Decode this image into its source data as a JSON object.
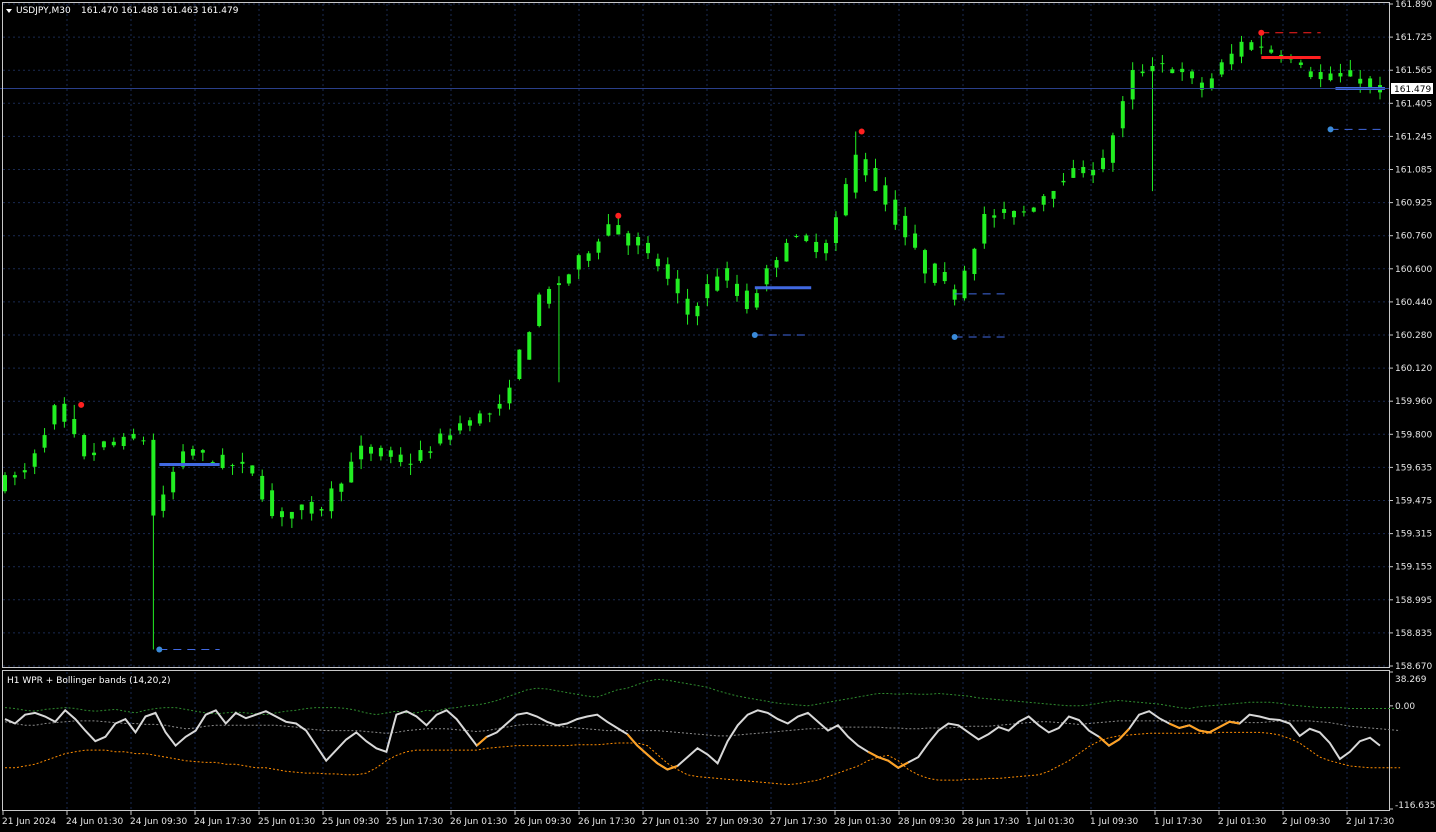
{
  "header": {
    "symbol_info": "USDJPY,M30",
    "ohlc": "161.470 161.488 161.463 161.479"
  },
  "indicator": {
    "title": "H1 WPR + Bollinger bands (14,20,2)",
    "scale_labels": [
      "38.269",
      "0.00",
      "-116.6359"
    ]
  },
  "current_price": "161.479",
  "price_axis": [
    "161.890",
    "161.725",
    "161.565",
    "161.405",
    "161.245",
    "161.085",
    "160.925",
    "160.760",
    "160.600",
    "160.440",
    "160.280",
    "160.120",
    "159.960",
    "159.800",
    "159.635",
    "159.475",
    "159.315",
    "159.155",
    "158.995",
    "158.835",
    "158.670"
  ],
  "time_axis": [
    "21 Jun 2024",
    "24 Jun 01:30",
    "24 Jun 09:30",
    "24 Jun 17:30",
    "25 Jun 01:30",
    "25 Jun 09:30",
    "25 Jun 17:30",
    "26 Jun 01:30",
    "26 Jun 09:30",
    "26 Jun 17:30",
    "27 Jun 01:30",
    "27 Jun 09:30",
    "27 Jun 17:30",
    "28 Jun 01:30",
    "28 Jun 09:30",
    "28 Jun 17:30",
    "1 Jul 01:30",
    "1 Jul 09:30",
    "1 Jul 17:30",
    "2 Jul 01:30",
    "2 Jul 09:30",
    "2 Jul 17:30"
  ],
  "colors": {
    "background": "#000000",
    "grid": "#1a2a52",
    "candle": "#22ee22",
    "level": "#4169e1",
    "marker_high": "#ff2020",
    "marker_low": "#3a8ad8",
    "wpr": "#d8d8d8",
    "wpr_extreme": "#ffa020",
    "band_upper": "#2e8b2e",
    "band_mid": "#8a8a8a",
    "band_lower": "#ff8c00",
    "text": "#e6e6e6"
  },
  "chart_data": {
    "type": "candlestick",
    "y_range": [
      158.67,
      161.89
    ],
    "key_points": [
      {
        "t": 0,
        "p": 159.55
      },
      {
        "t": 3,
        "p": 159.62
      },
      {
        "t": 6,
        "p": 159.92
      },
      {
        "t": 9,
        "p": 159.7
      },
      {
        "t": 12,
        "p": 159.76
      },
      {
        "t": 15,
        "p": 159.78
      },
      {
        "t": 16,
        "p": 159.4
      },
      {
        "t": 19,
        "p": 159.72
      },
      {
        "t": 23,
        "p": 159.65
      },
      {
        "t": 26,
        "p": 159.62
      },
      {
        "t": 28,
        "p": 159.4
      },
      {
        "t": 33,
        "p": 159.45
      },
      {
        "t": 37,
        "p": 159.72
      },
      {
        "t": 42,
        "p": 159.66
      },
      {
        "t": 47,
        "p": 159.85
      },
      {
        "t": 51,
        "p": 159.92
      },
      {
        "t": 55,
        "p": 160.45
      },
      {
        "t": 58,
        "p": 160.58
      },
      {
        "t": 62,
        "p": 160.82
      },
      {
        "t": 67,
        "p": 160.62
      },
      {
        "t": 70,
        "p": 160.38
      },
      {
        "t": 73,
        "p": 160.58
      },
      {
        "t": 76,
        "p": 160.42
      },
      {
        "t": 80,
        "p": 160.75
      },
      {
        "t": 84,
        "p": 160.7
      },
      {
        "t": 87,
        "p": 161.15
      },
      {
        "t": 90,
        "p": 160.92
      },
      {
        "t": 94,
        "p": 160.6
      },
      {
        "t": 97,
        "p": 160.48
      },
      {
        "t": 100,
        "p": 160.85
      },
      {
        "t": 104,
        "p": 160.88
      },
      {
        "t": 108,
        "p": 161.05
      },
      {
        "t": 112,
        "p": 161.12
      },
      {
        "t": 115,
        "p": 161.55
      },
      {
        "t": 118,
        "p": 161.6
      },
      {
        "t": 122,
        "p": 161.48
      },
      {
        "t": 126,
        "p": 161.7
      },
      {
        "t": 130,
        "p": 161.65
      },
      {
        "t": 134,
        "p": 161.52
      },
      {
        "t": 137,
        "p": 161.55
      },
      {
        "t": 139,
        "p": 161.479
      }
    ],
    "levels": [
      {
        "p": 159.65,
        "t0": 15.6,
        "t1": 21.7,
        "style": "solid"
      },
      {
        "p": 158.75,
        "t0": 15.6,
        "t1": 21.7,
        "style": "dashed"
      },
      {
        "p": 160.51,
        "t0": 75.8,
        "t1": 81.5,
        "style": "solid"
      },
      {
        "p": 160.28,
        "t0": 75.8,
        "t1": 81.5,
        "style": "dashed"
      },
      {
        "p": 160.48,
        "t0": 96.0,
        "t1": 101.3,
        "style": "dashed"
      },
      {
        "p": 160.27,
        "t0": 96.0,
        "t1": 101.3,
        "style": "dashed"
      },
      {
        "p": 161.75,
        "t0": 127.0,
        "t1": 133.0,
        "style": "dashed"
      },
      {
        "p": 161.63,
        "t0": 127.0,
        "t1": 133.0,
        "style": "solid-red"
      },
      {
        "p": 161.28,
        "t0": 134.0,
        "t1": 139.5,
        "style": "dashed"
      },
      {
        "p": 161.479,
        "t0": 134.5,
        "t1": 139.5,
        "style": "solid"
      }
    ],
    "markers": [
      {
        "t": 7.7,
        "p": 159.94,
        "kind": "high"
      },
      {
        "t": 15.6,
        "p": 158.75,
        "kind": "low"
      },
      {
        "t": 62.0,
        "p": 160.86,
        "kind": "high"
      },
      {
        "t": 75.8,
        "p": 160.28,
        "kind": "low"
      },
      {
        "t": 86.6,
        "p": 161.27,
        "kind": "high"
      },
      {
        "t": 96.0,
        "p": 160.27,
        "kind": "low"
      },
      {
        "t": 127.0,
        "p": 161.75,
        "kind": "high"
      },
      {
        "t": 134.0,
        "p": 161.28,
        "kind": "low"
      }
    ],
    "wpr": [
      -15,
      -20,
      -10,
      -8,
      -12,
      -18,
      -5,
      -15,
      -28,
      -40,
      -35,
      -20,
      -15,
      -30,
      -12,
      -8,
      -30,
      -45,
      -35,
      -28,
      -10,
      -5,
      -20,
      -8,
      -14,
      -10,
      -6,
      -12,
      -18,
      -20,
      -28,
      -45,
      -62,
      -50,
      -38,
      -30,
      -40,
      -48,
      -52,
      -10,
      -6,
      -12,
      -22,
      -10,
      -5,
      -15,
      -30,
      -45,
      -35,
      -30,
      -20,
      -10,
      -8,
      -12,
      -18,
      -22,
      -20,
      -15,
      -12,
      -10,
      -18,
      -25,
      -32,
      -45,
      -55,
      -65,
      -72,
      -68,
      -58,
      -48,
      -55,
      -65,
      -40,
      -22,
      -10,
      -5,
      -8,
      -15,
      -20,
      -12,
      -8,
      -18,
      -28,
      -22,
      -35,
      -45,
      -52,
      -58,
      -62,
      -70,
      -64,
      -58,
      -42,
      -28,
      -20,
      -22,
      -30,
      -38,
      -32,
      -24,
      -28,
      -18,
      -12,
      -22,
      -30,
      -25,
      -12,
      -16,
      -28,
      -35,
      -45,
      -38,
      -26,
      -10,
      -6,
      -14,
      -20,
      -25,
      -22,
      -28,
      -30,
      -24,
      -18,
      -20,
      -10,
      -12,
      -15,
      -16,
      -20,
      -34,
      -26,
      -30,
      -42,
      -60,
      -52,
      -40,
      -36,
      -45
    ],
    "band_upper": [
      -2,
      -3,
      -5,
      -6,
      -4,
      -3,
      -2,
      -3,
      -5,
      -6,
      -5,
      -4,
      -6,
      -8,
      -5,
      -3,
      -2,
      -2,
      -4,
      -6,
      -8,
      -9,
      -8,
      -7,
      -8,
      -9,
      -10,
      -8,
      -6,
      -5,
      -3,
      -2,
      -2,
      -2,
      -3,
      -5,
      -8,
      -10,
      -8,
      -6,
      -8,
      -8,
      -5,
      -6,
      -3,
      -2,
      0,
      1,
      3,
      6,
      10,
      14,
      18,
      20,
      19,
      17,
      15,
      13,
      11,
      10,
      14,
      18,
      20,
      24,
      28,
      30,
      29,
      27,
      25,
      23,
      21,
      17,
      14,
      11,
      9,
      7,
      5,
      3,
      2,
      1,
      0,
      2,
      4,
      6,
      8,
      10,
      12,
      14,
      14,
      13,
      14,
      13,
      13,
      14,
      13,
      12,
      11,
      9,
      8,
      7,
      6,
      5,
      4,
      3,
      2,
      1,
      0,
      0,
      1,
      3,
      5,
      6,
      5,
      4,
      3,
      2,
      0,
      -2,
      -3,
      -1,
      0,
      1,
      2,
      3,
      4,
      4,
      4,
      3,
      1,
      0,
      -1,
      -2,
      -2,
      -2,
      -3,
      -3,
      -3,
      -3,
      -3,
      -3
    ],
    "band_middle": [
      -18,
      -20,
      -22,
      -22,
      -20,
      -19,
      -18,
      -17,
      -17,
      -17,
      -18,
      -19,
      -20,
      -20,
      -21,
      -21,
      -22,
      -24,
      -26,
      -25,
      -23,
      -22,
      -22,
      -22,
      -22,
      -22,
      -22,
      -22,
      -23,
      -24,
      -26,
      -27,
      -28,
      -28,
      -28,
      -28,
      -29,
      -30,
      -31,
      -30,
      -28,
      -27,
      -26,
      -26,
      -26,
      -27,
      -28,
      -29,
      -28,
      -26,
      -24,
      -22,
      -21,
      -21,
      -22,
      -23,
      -24,
      -25,
      -26,
      -27,
      -28,
      -28,
      -28,
      -28,
      -28,
      -28,
      -29,
      -30,
      -31,
      -32,
      -33,
      -34,
      -34,
      -33,
      -32,
      -31,
      -30,
      -29,
      -28,
      -27,
      -26,
      -26,
      -25,
      -24,
      -24,
      -24,
      -24,
      -24,
      -25,
      -25,
      -26,
      -26,
      -25,
      -25,
      -25,
      -24,
      -23,
      -23,
      -23,
      -22,
      -21,
      -20,
      -19,
      -18,
      -18,
      -19,
      -20,
      -21,
      -20,
      -19,
      -18,
      -17,
      -17,
      -17,
      -17,
      -17,
      -17,
      -17,
      -17,
      -17,
      -17,
      -17,
      -17,
      -18,
      -19,
      -19,
      -18,
      -17,
      -17,
      -17,
      -17,
      -18,
      -19,
      -21,
      -23,
      -24,
      -25,
      -26,
      -27,
      -28
    ],
    "band_lower": [
      -70,
      -70,
      -68,
      -66,
      -62,
      -58,
      -54,
      -52,
      -50,
      -50,
      -50,
      -52,
      -52,
      -54,
      -54,
      -56,
      -58,
      -60,
      -62,
      -63,
      -64,
      -64,
      -66,
      -66,
      -68,
      -70,
      -70,
      -72,
      -74,
      -75,
      -76,
      -76,
      -77,
      -77,
      -78,
      -78,
      -76,
      -70,
      -62,
      -56,
      -52,
      -50,
      -50,
      -50,
      -50,
      -50,
      -50,
      -50,
      -48,
      -47,
      -46,
      -45,
      -45,
      -45,
      -45,
      -45,
      -45,
      -44,
      -44,
      -44,
      -43,
      -42,
      -42,
      -42,
      -45,
      -55,
      -65,
      -72,
      -78,
      -80,
      -81,
      -82,
      -83,
      -84,
      -85,
      -86,
      -87,
      -88,
      -89,
      -88,
      -86,
      -84,
      -80,
      -76,
      -72,
      -68,
      -62,
      -58,
      -56,
      -62,
      -72,
      -78,
      -82,
      -84,
      -84,
      -84,
      -83,
      -83,
      -82,
      -82,
      -81,
      -80,
      -79,
      -78,
      -74,
      -68,
      -62,
      -54,
      -46,
      -40,
      -36,
      -34,
      -33,
      -32,
      -31,
      -31,
      -31,
      -31,
      -31,
      -31,
      -31,
      -30,
      -30,
      -30,
      -30,
      -30,
      -31,
      -33,
      -37,
      -42,
      -50,
      -58,
      -62,
      -65,
      -68,
      -69,
      -70,
      -70,
      -70,
      -70
    ]
  }
}
